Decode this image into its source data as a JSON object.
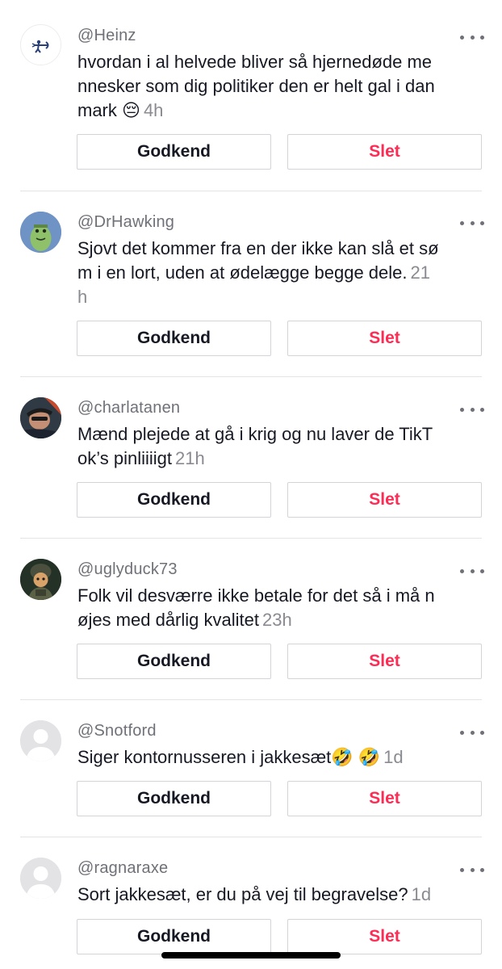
{
  "comments": [
    {
      "username": "@Heinz",
      "lines": [
        "hvordan i al helvede bliver så hjernedøde me",
        "nnesker som dig politiker den er helt gal i dan",
        "mark 😔"
      ],
      "time": "4h",
      "approve_label": "Godkend",
      "delete_label": "Slet",
      "avatar_icon": "archer-logo-icon"
    },
    {
      "username": "@DrHawking",
      "lines": [
        "Sjovt det kommer fra en der ikke kan slå et sø",
        "m i en lort, uden at ødelægge begge dele."
      ],
      "time": "21",
      "time_wrap": "h",
      "approve_label": "Godkend",
      "delete_label": "Slet",
      "avatar_icon": "cartoon-face-icon"
    },
    {
      "username": "@charlatanen",
      "lines": [
        "Mænd plejede at gå i krig og nu laver de TikT",
        "ok’s pinliiiigt"
      ],
      "time": "21h",
      "approve_label": "Godkend",
      "delete_label": "Slet",
      "avatar_icon": "photo-avatar-icon"
    },
    {
      "username": "@uglyduck73",
      "lines": [
        "Folk vil desværre ikke betale for det så i må n",
        "øjes med dårlig kvalitet"
      ],
      "time": "23h",
      "approve_label": "Godkend",
      "delete_label": "Slet",
      "avatar_icon": "soldier-avatar-icon"
    },
    {
      "username": "@Snotford",
      "lines": [
        "Siger kontornusseren i jakkesæt🤣 🤣"
      ],
      "time": "1d",
      "approve_label": "Godkend",
      "delete_label": "Slet",
      "avatar_icon": "default-avatar-icon"
    },
    {
      "username": "@ragnaraxe",
      "lines": [
        "Sort jakkesæt, er du på vej til begravelse?"
      ],
      "time": "1d",
      "approve_label": "Godkend",
      "delete_label": "Slet",
      "avatar_icon": "default-avatar-icon"
    }
  ],
  "colors": {
    "delete": "#fe2c55",
    "secondary_text": "#8a8b91",
    "username": "#6f7178",
    "primary_text": "#161823"
  }
}
